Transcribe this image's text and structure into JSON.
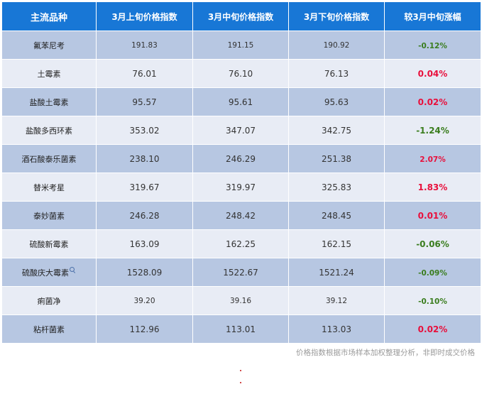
{
  "headers": [
    "主流品种",
    "3月上旬价格指数",
    "3月中旬价格指数",
    "3月下旬价格指数",
    "较3月中旬涨幅"
  ],
  "rows": [
    {
      "name": "氟苯尼考",
      "early": "191.83",
      "mid": "191.15",
      "late": "190.92",
      "change": "-0.12%"
    },
    {
      "name": "土霉素",
      "early": "76.01",
      "mid": "76.10",
      "late": "76.13",
      "change": "0.04%"
    },
    {
      "name": "盐酸土霉素",
      "early": "95.57",
      "mid": "95.61",
      "late": "95.63",
      "change": "0.02%"
    },
    {
      "name": "盐酸多西环素",
      "early": "353.02",
      "mid": "347.07",
      "late": "342.75",
      "change": "-1.24%"
    },
    {
      "name": "酒石酸泰乐菌素",
      "early": "238.10",
      "mid": "246.29",
      "late": "251.38",
      "change": "2.07%"
    },
    {
      "name": "替米考星",
      "early": "319.67",
      "mid": "319.97",
      "late": "325.83",
      "change": "1.83%"
    },
    {
      "name": "泰妙菌素",
      "early": "246.28",
      "mid": "248.42",
      "late": "248.45",
      "change": "0.01%"
    },
    {
      "name": "硫酸新霉素",
      "early": "163.09",
      "mid": "162.25",
      "late": "162.15",
      "change": "-0.06%"
    },
    {
      "name": "硫酸庆大霉素",
      "early": "1528.09",
      "mid": "1522.67",
      "late": "1521.24",
      "change": "-0.09%"
    },
    {
      "name": "痢菌净",
      "early": "39.20",
      "mid": "39.16",
      "late": "39.12",
      "change": "-0.10%"
    },
    {
      "name": "粘杆菌素",
      "early": "112.96",
      "mid": "113.01",
      "late": "113.03",
      "change": "0.02%"
    }
  ],
  "footnote": "价格指数根据市场样本加权整理分析，非即时成交价格",
  "colors": {
    "header_bg": "#1877d6",
    "row_dark": "#b7c7e2",
    "row_light": "#e8ecf5",
    "negative": "#3a7d1e",
    "positive": "#e8103c"
  }
}
